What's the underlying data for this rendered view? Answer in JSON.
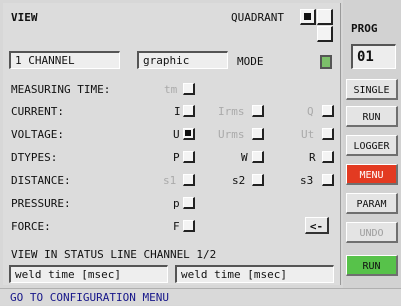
{
  "view": {
    "title": "VIEW",
    "quadrant_label": "QUADRANT",
    "channel_value": "1 CHANNEL",
    "display_value": "graphic",
    "mode_label": "MODE"
  },
  "rows": {
    "measuring_time": {
      "label": "MEASURING TIME:",
      "tm": "tm"
    },
    "current": {
      "label": "CURRENT:",
      "i": "I",
      "irms": "Irms",
      "q": "Q"
    },
    "voltage": {
      "label": "VOLTAGE:",
      "u": "U",
      "urms": "Urms",
      "ut": "Ut"
    },
    "dtypes": {
      "label": "DTYPES:",
      "p": "P",
      "w": "W",
      "r": "R"
    },
    "distance": {
      "label": "DISTANCE:",
      "s1": "s1",
      "s2": "s2",
      "s3": "s3"
    },
    "pressure": {
      "label": "PRESSURE:",
      "p": "p"
    },
    "force": {
      "label": "FORCE:",
      "f": "F"
    }
  },
  "back_button": "<-",
  "status_line": {
    "label": "VIEW IN STATUS LINE CHANNEL 1/2",
    "field1": "weld time [msec]",
    "field2": "weld time [msec]"
  },
  "side": {
    "prog_title": "PROG",
    "prog_value": "01",
    "buttons": [
      "SINGLE",
      "RUN",
      "LOGGER",
      "MENU",
      "PARAM",
      "UNDO",
      "RUN"
    ]
  },
  "footer": "GO TO CONFIGURATION MENU"
}
